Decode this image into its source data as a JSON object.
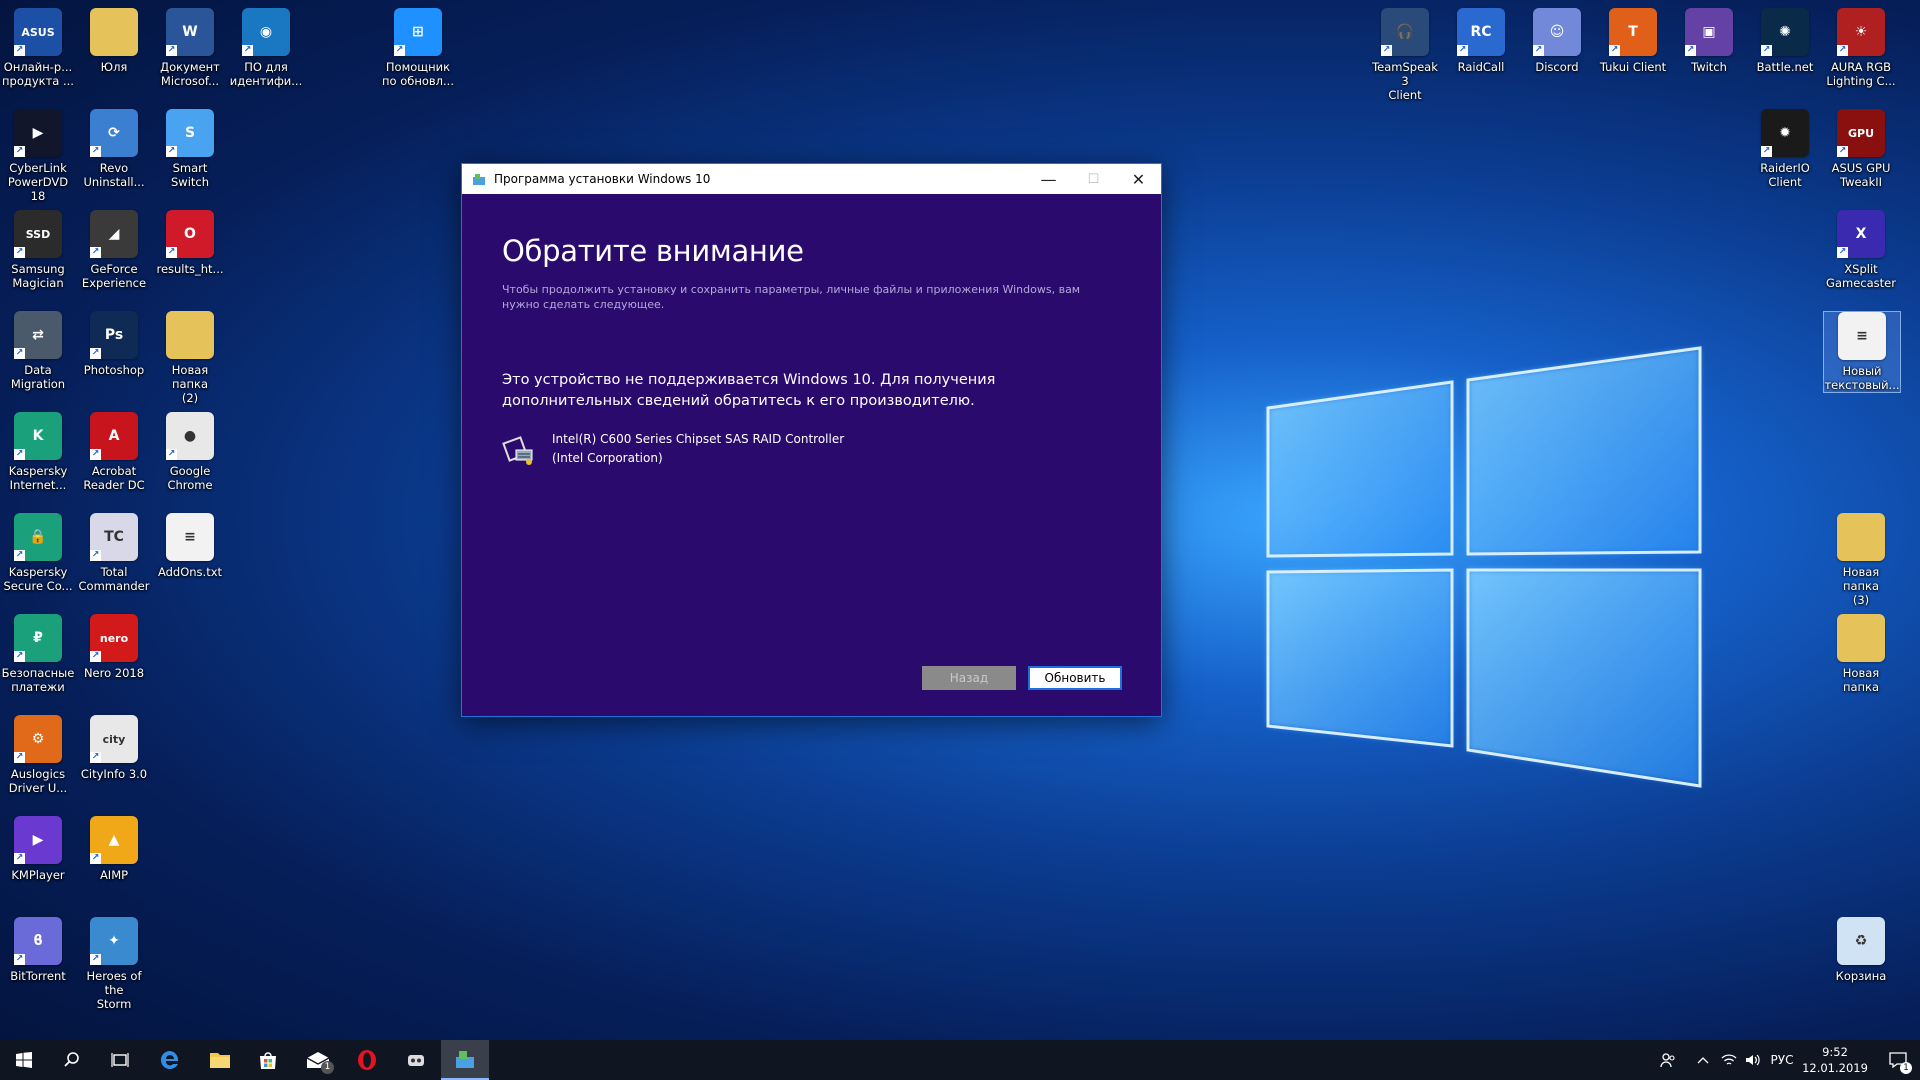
{
  "desktop": {
    "left_icons": [
      {
        "label": "Онлайн-р...\nпродукта ...",
        "icon": "asus-icon",
        "color": "#1c4fa6",
        "glyph": "ASUS"
      },
      {
        "label": "Юля",
        "icon": "folder-icon",
        "color": "#e6c25a",
        "glyph": ""
      },
      {
        "label": "Документ\nMicrosof...",
        "icon": "word-icon",
        "color": "#2a5699",
        "glyph": "W"
      },
      {
        "label": "ПО для\nидентифи...",
        "icon": "intel-tool-icon",
        "color": "#1a78c2",
        "glyph": "◉"
      },
      {
        "label": "Помощник\nпо обновл...",
        "icon": "windows-update-icon",
        "color": "#1e90ff",
        "glyph": "⊞"
      },
      {
        "label": "CyberLink\nPowerDVD 18",
        "icon": "powerdvd-icon",
        "color": "#11162a",
        "glyph": "▶"
      },
      {
        "label": "Revo\nUninstall...",
        "icon": "revo-icon",
        "color": "#3a7fd0",
        "glyph": "⟳"
      },
      {
        "label": "Smart Switch",
        "icon": "smart-switch-icon",
        "color": "#4aa3f0",
        "glyph": "S"
      },
      {
        "label": "Samsung\nMagician",
        "icon": "samsung-magician-icon",
        "color": "#2b2b2b",
        "glyph": "SSD"
      },
      {
        "label": "GeForce\nExperience",
        "icon": "geforce-icon",
        "color": "#3a3a3a",
        "glyph": "◢"
      },
      {
        "label": "results_ht...",
        "icon": "opera-file-icon",
        "color": "#d01a2a",
        "glyph": "O"
      },
      {
        "label": "Data\nMigration",
        "icon": "data-migration-icon",
        "color": "#4a5a6a",
        "glyph": "⇄"
      },
      {
        "label": "Photoshop",
        "icon": "photoshop-icon",
        "color": "#0f2a55",
        "glyph": "Ps"
      },
      {
        "label": "Новая папка\n(2)",
        "icon": "folder-icon",
        "color": "#e6c25a",
        "glyph": ""
      },
      {
        "label": "Kaspersky\nInternet...",
        "icon": "kaspersky-icon",
        "color": "#1aa07a",
        "glyph": "K"
      },
      {
        "label": "Acrobat\nReader DC",
        "icon": "acrobat-icon",
        "color": "#c8141c",
        "glyph": "A"
      },
      {
        "label": "Google\nChrome",
        "icon": "chrome-icon",
        "color": "#e8e8e8",
        "glyph": "●"
      },
      {
        "label": "Kaspersky\nSecure Co...",
        "icon": "kaspersky-secure-icon",
        "color": "#1aa07a",
        "glyph": "🔒"
      },
      {
        "label": "Total\nCommander",
        "icon": "total-commander-icon",
        "color": "#d8d8e8",
        "glyph": "TC"
      },
      {
        "label": "AddOns.txt",
        "icon": "text-file-icon",
        "color": "#f2f2f2",
        "glyph": "≡"
      },
      {
        "label": "Безопасные\nплатежи",
        "icon": "safe-money-icon",
        "color": "#1aa07a",
        "glyph": "₽"
      },
      {
        "label": "Nero 2018",
        "icon": "nero-icon",
        "color": "#d21a1a",
        "glyph": "nero"
      },
      {
        "label": "Auslogics\nDriver U...",
        "icon": "auslogics-icon",
        "color": "#e06a1a",
        "glyph": "⚙"
      },
      {
        "label": "CityInfo 3.0",
        "icon": "cityinfo-icon",
        "color": "#e8e8e8",
        "glyph": "city"
      },
      {
        "label": "KMPlayer",
        "icon": "kmplayer-icon",
        "color": "#6a3ad0",
        "glyph": "▶"
      },
      {
        "label": "AIMP",
        "icon": "aimp-icon",
        "color": "#f0a818",
        "glyph": "▲"
      },
      {
        "label": "BitTorrent",
        "icon": "bittorrent-icon",
        "color": "#6a6ad8",
        "glyph": "ϐ"
      },
      {
        "label": "Heroes of the\nStorm",
        "icon": "heroes-icon",
        "color": "#3a8ad0",
        "glyph": "✦"
      }
    ],
    "right_icons": [
      {
        "label": "TeamSpeak 3\nClient",
        "icon": "teamspeak-icon",
        "color": "#2a4a7a",
        "glyph": "🎧"
      },
      {
        "label": "RaidCall",
        "icon": "raidcall-icon",
        "color": "#2a6ad0",
        "glyph": "RC"
      },
      {
        "label": "Discord",
        "icon": "discord-icon",
        "color": "#7289da",
        "glyph": "☺"
      },
      {
        "label": "Tukui Client",
        "icon": "tukui-icon",
        "color": "#e0601a",
        "glyph": "T"
      },
      {
        "label": "Twitch",
        "icon": "twitch-icon",
        "color": "#6441a5",
        "glyph": "▣"
      },
      {
        "label": "Battle.net",
        "icon": "battlenet-icon",
        "color": "#0a2a4a",
        "glyph": "✺"
      },
      {
        "label": "AURA RGB\nLighting C...",
        "icon": "aura-icon",
        "color": "#b02020",
        "glyph": "☀"
      },
      {
        "label": "RaiderIO\nClient",
        "icon": "raiderio-icon",
        "color": "#1a1a1a",
        "glyph": "✹"
      },
      {
        "label": "ASUS GPU\nTweakII",
        "icon": "gpu-tweak-icon",
        "color": "#8a1010",
        "glyph": "GPU"
      },
      {
        "label": "XSplit\nGamecaster",
        "icon": "xsplit-icon",
        "color": "#3a2ab0",
        "glyph": "X"
      },
      {
        "label": "Новый\nтекстовый...",
        "icon": "text-file-icon",
        "color": "#f2f2f2",
        "glyph": "≡"
      },
      {
        "label": "Новая папка\n(3)",
        "icon": "folder-icon",
        "color": "#e6c25a",
        "glyph": ""
      },
      {
        "label": "Новая папка",
        "icon": "folder-icon",
        "color": "#e6c25a",
        "glyph": ""
      },
      {
        "label": "Корзина",
        "icon": "recycle-bin-icon",
        "color": "#cfe3f5",
        "glyph": "♻"
      }
    ]
  },
  "dialog": {
    "title": "Программа установки Windows 10",
    "heading": "Обратите внимание",
    "subtext": "Чтобы продолжить установку и сохранить параметры, личные файлы и приложения Windows, вам нужно сделать следующее.",
    "message": "Это устройство не поддерживается Windows 10. Для получения дополнительных сведений обратитесь к его производителю.",
    "device_name": "Intel(R) C600 Series Chipset SAS RAID Controller",
    "device_vendor": "(Intel Corporation)",
    "back_label": "Назад",
    "update_label": "Обновить",
    "minimize_glyph": "—",
    "maximize_glyph": "☐",
    "close_glyph": "✕"
  },
  "taskbar": {
    "items": [
      "start-icon",
      "search-icon",
      "task-view-icon",
      "edge-icon",
      "explorer-icon",
      "store-icon",
      "mail-icon",
      "opera-icon",
      "media-icon",
      "setup-icon"
    ],
    "mail_badge": "1",
    "language": "РУС",
    "time": "9:52",
    "date": "12.01.2019",
    "notification_badge": "1"
  },
  "colors": {
    "dialog_bg": "#2b0a6e",
    "accent": "#1e6fe0",
    "taskbar_bg": "#101522"
  }
}
